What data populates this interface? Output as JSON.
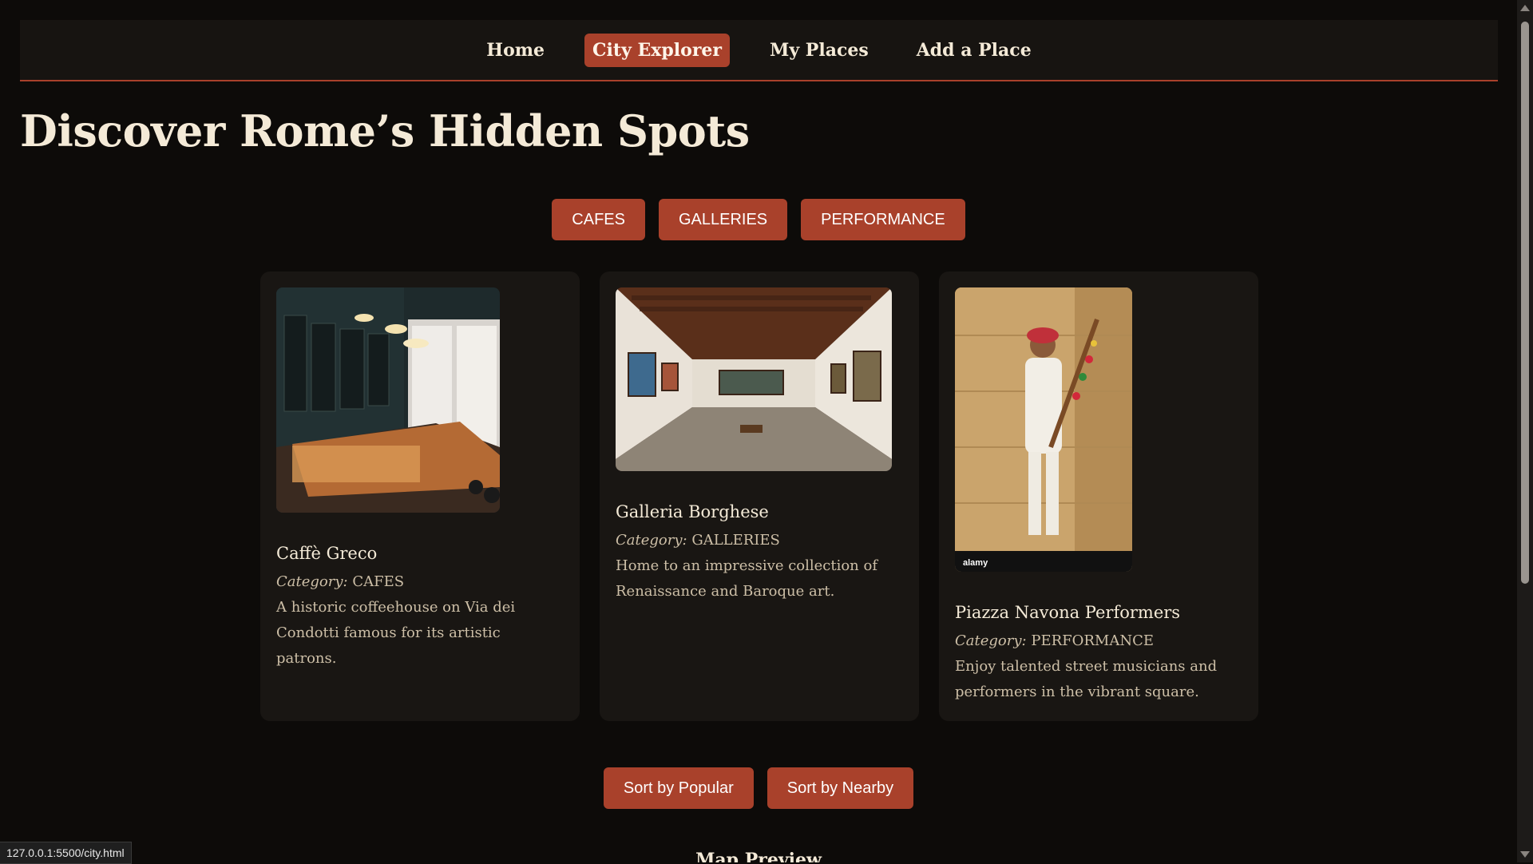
{
  "nav": {
    "items": [
      {
        "label": "Home",
        "active": false
      },
      {
        "label": "City Explorer",
        "active": true
      },
      {
        "label": "My Places",
        "active": false
      },
      {
        "label": "Add a Place",
        "active": false
      }
    ]
  },
  "page_title": "Discover Rome’s Hidden Spots",
  "filters": [
    "CAFES",
    "GALLERIES",
    "PERFORMANCE"
  ],
  "cards": [
    {
      "title": "Caffè Greco",
      "category_label": "Category:",
      "category": "CAFES",
      "description": "A historic coffeehouse on Via dei Condotti famous for its artistic patrons.",
      "image": "cafe-interior-photo"
    },
    {
      "title": "Galleria Borghese",
      "category_label": "Category:",
      "category": "GALLERIES",
      "description": "Home to an impressive collection of Renaissance and Baroque art.",
      "image": "gallery-room-photo"
    },
    {
      "title": "Piazza Navona Performers",
      "category_label": "Category:",
      "category": "PERFORMANCE",
      "description": "Enjoy talented street musicians and performers in the vibrant square.",
      "image": "street-musician-photo",
      "watermark": "alamy"
    }
  ],
  "sort_buttons": [
    "Sort by Popular",
    "Sort by Nearby"
  ],
  "map_heading": "Map Preview",
  "status_url": "127.0.0.1:5500/city.html",
  "colors": {
    "background": "#0d0b09",
    "nav_background": "#171411",
    "card_background": "#191613",
    "accent": "#a9412b",
    "text": "#f4ead7",
    "muted_text": "#cdbfa7"
  }
}
